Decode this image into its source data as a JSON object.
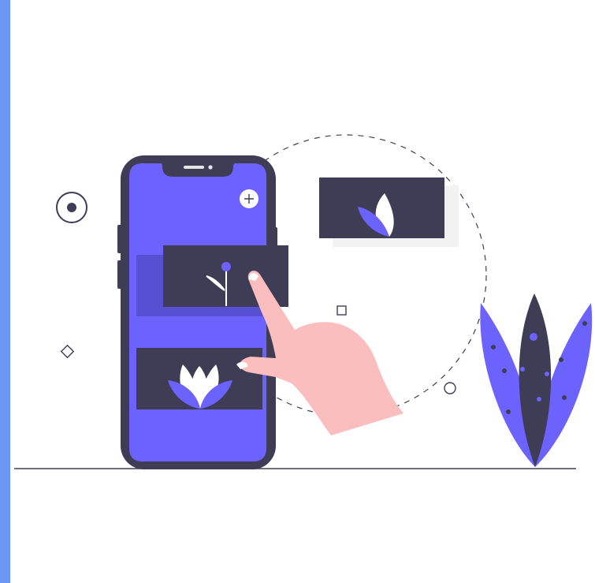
{
  "colors": {
    "accent_strip": "#6b97f7",
    "primary": "#6c63ff",
    "dark": "#3f3d56",
    "skin": "#fbbebe",
    "light": "#ffffff",
    "shadow": "#f2f2f2",
    "ground": "#3f3d56"
  },
  "illustration": {
    "phone": {
      "plus_icon": "plus-icon",
      "cards": [
        "sprout-card",
        "lotus-card"
      ]
    },
    "floating_card": "leaf-card",
    "hand": "pointing-hand",
    "plant": "leaf-plant",
    "decorations": [
      "target-circle-icon",
      "square-outline-icon",
      "diamond-outline-icon",
      "circle-outline-icon",
      "dashed-circle"
    ]
  }
}
